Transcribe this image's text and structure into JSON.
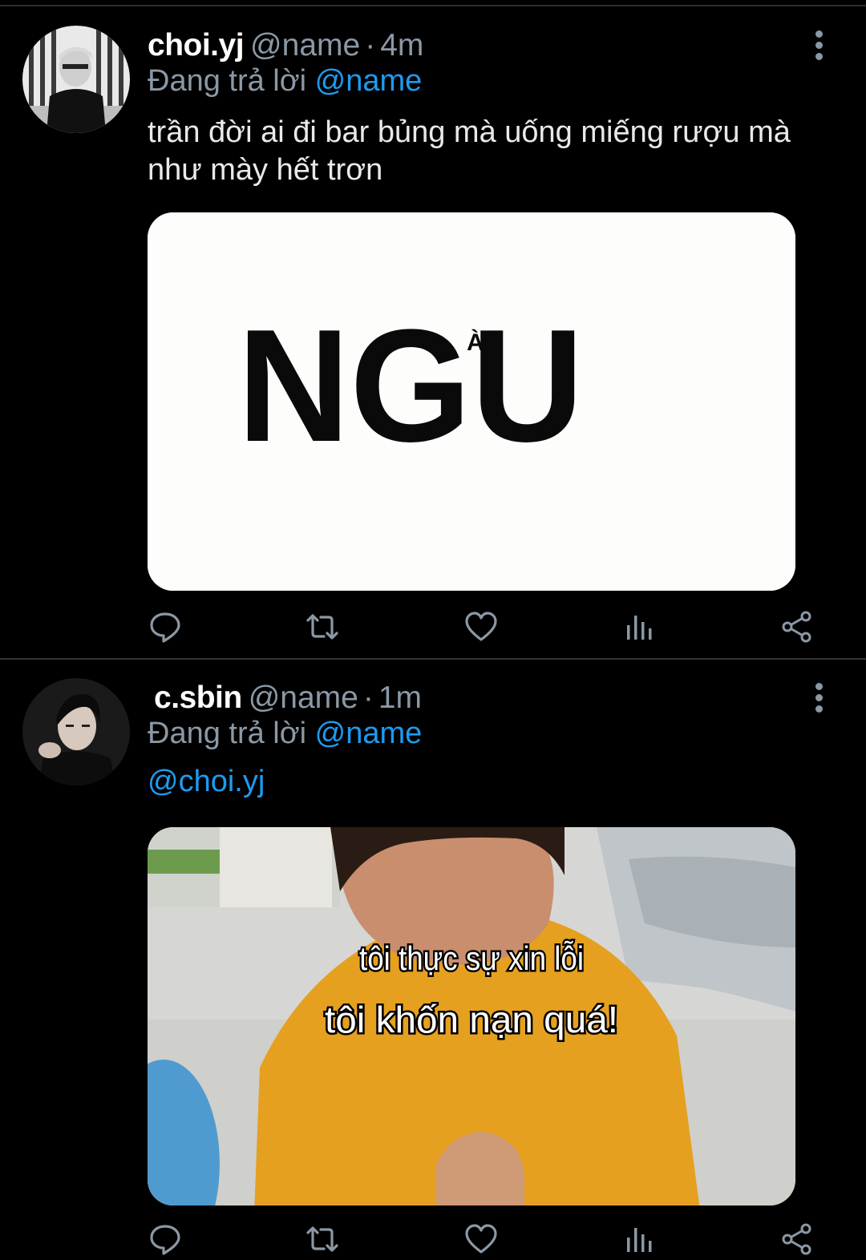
{
  "tweets": [
    {
      "display_name": "choi.yj",
      "handle": "@name",
      "separator": "·",
      "time": "4m",
      "reply_prefix": "Đang trả lời",
      "reply_handle": "@name",
      "text": "trần đời ai đi bar bủng mà uống miếng rượu mà như mày hết trơn",
      "media_text_main": "NGU",
      "media_text_accent": "À"
    },
    {
      "display_name": "c.sbin",
      "handle": "@name",
      "separator": "·",
      "time": "1m",
      "reply_prefix": "Đang trả lời",
      "reply_handle": "@name",
      "mention": "@choi.yj",
      "media_caption_line1": "tôi thực sự xin lỗi",
      "media_caption_line2": "tôi khốn nạn quá!"
    }
  ],
  "icons": [
    "reply-icon",
    "retweet-icon",
    "like-icon",
    "analytics-icon",
    "share-icon",
    "more-icon"
  ],
  "colors": {
    "background": "#000000",
    "secondary_text": "#8b98a5",
    "link": "#1d9bf0",
    "divider": "#2f3336"
  }
}
